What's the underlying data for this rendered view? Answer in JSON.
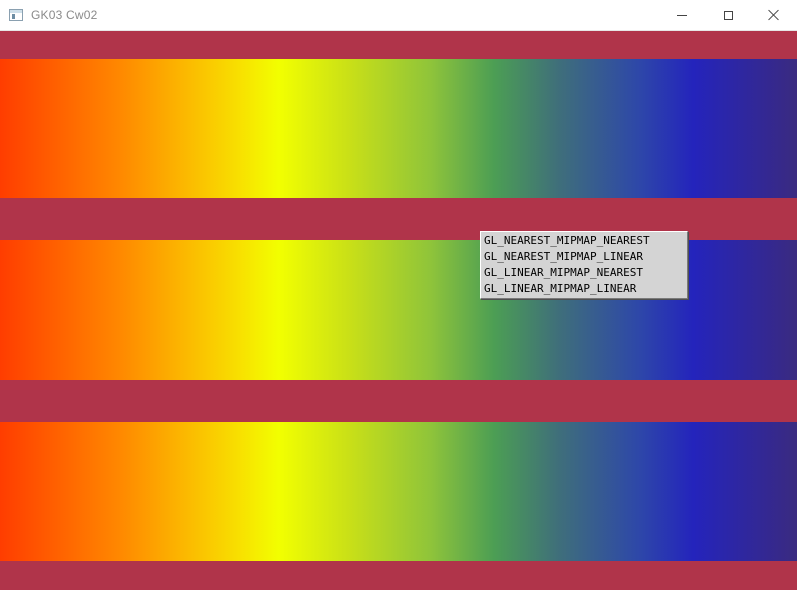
{
  "window": {
    "title": "GK03 Cw02",
    "icon": "app-window-icon",
    "controls": [
      "minimize-icon",
      "maximize-icon",
      "close-icon"
    ]
  },
  "canvas": {
    "background_color": "#b0344a",
    "gradient_colors": [
      "#ff3d00",
      "#ff8800",
      "#f2ff00",
      "#8fc43a",
      "#4c9e54",
      "#2424bc",
      "#3a2a80"
    ],
    "band_count": 3
  },
  "context_menu": {
    "items": [
      {
        "label": "GL_NEAREST_MIPMAP_NEAREST"
      },
      {
        "label": "GL_NEAREST_MIPMAP_LINEAR"
      },
      {
        "label": "GL_LINEAR_MIPMAP_NEAREST"
      },
      {
        "label": "GL_LINEAR_MIPMAP_LINEAR"
      }
    ]
  }
}
